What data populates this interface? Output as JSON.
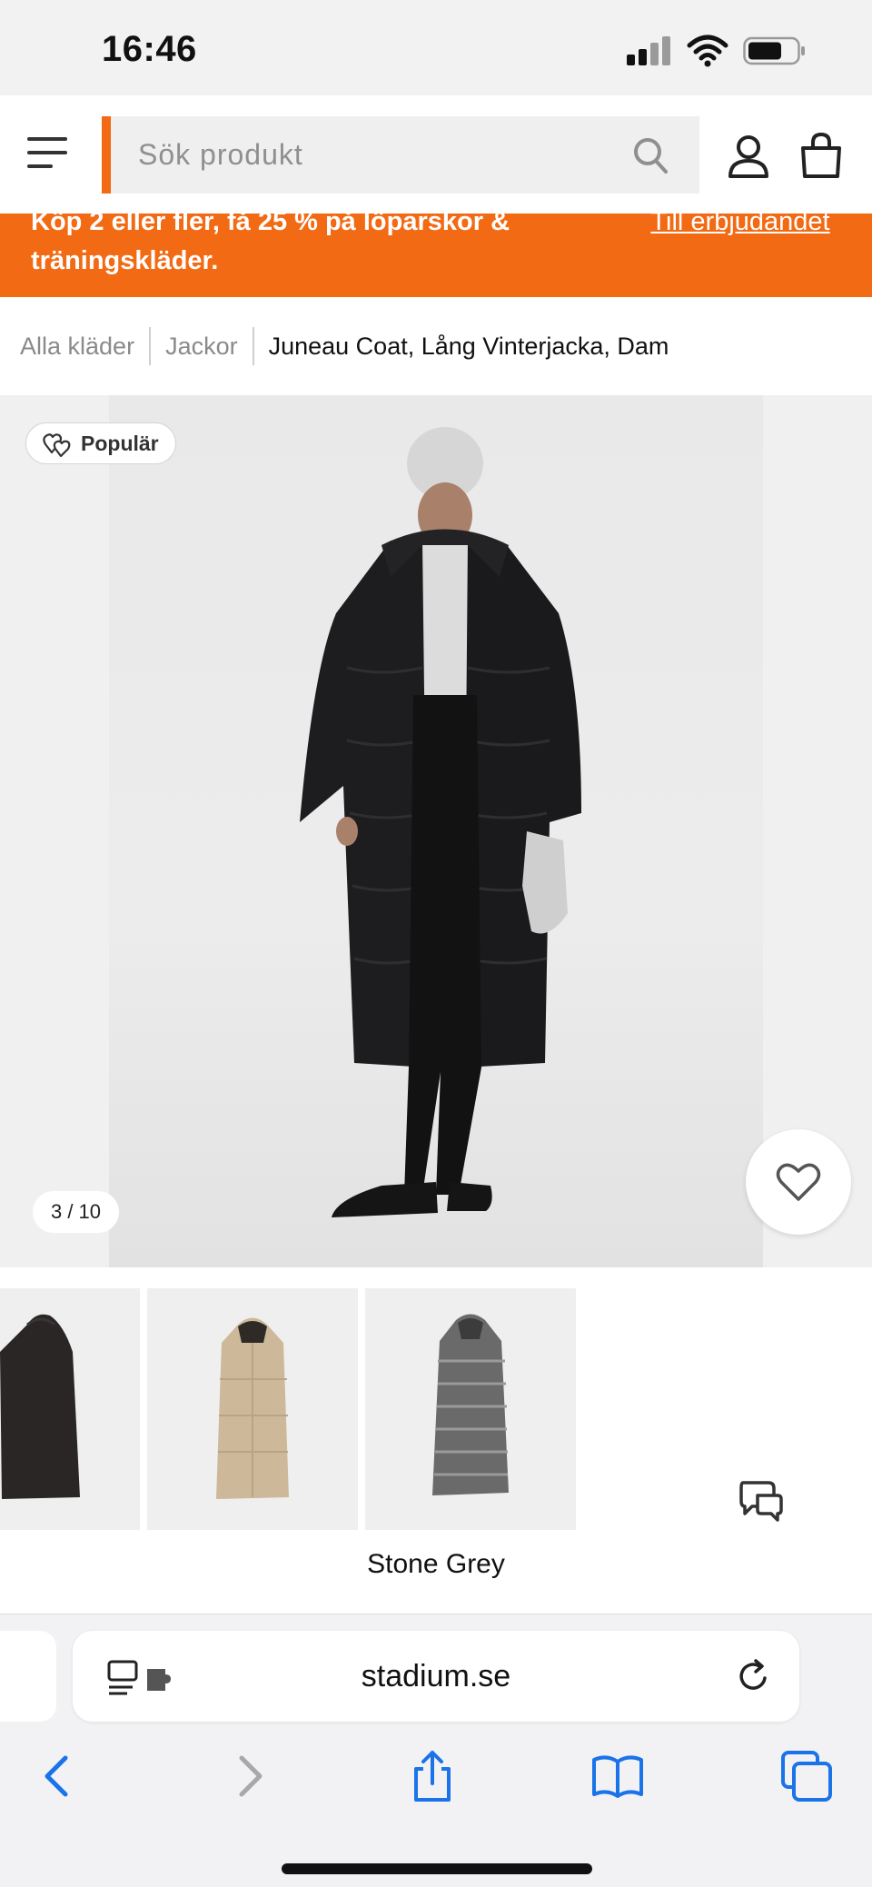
{
  "status_bar": {
    "time": "16:46",
    "icons": [
      "cellular-signal-icon",
      "wifi-icon",
      "battery-icon"
    ]
  },
  "header": {
    "search": {
      "placeholder": "Sök produkt"
    },
    "icons": [
      "hamburger-menu-icon",
      "search-icon",
      "user-icon",
      "shopping-bag-icon"
    ],
    "accent_color": "#f26a13"
  },
  "promo": {
    "text": "Köp 2 eller fler, få 25 % på löparskor & träningskläder.",
    "link": "Till erbjudandet",
    "background": "#f26a13"
  },
  "breadcrumb": {
    "items": [
      "Alla kläder",
      "Jackor"
    ],
    "current": "Juneau Coat, Lång Vinterjacka, Dam"
  },
  "gallery": {
    "badge": "Populär",
    "counter": "3 / 10",
    "image_alt": "Model wearing long black winter coat"
  },
  "variants": {
    "selected_color": "Stone Grey",
    "thumbnails": [
      "Black coat",
      "Beige coat",
      "Stone Grey coat"
    ]
  },
  "browser": {
    "url": "stadium.se",
    "toolbar": [
      "back-icon",
      "forward-icon",
      "share-icon",
      "bookmarks-icon",
      "tabs-icon"
    ]
  }
}
